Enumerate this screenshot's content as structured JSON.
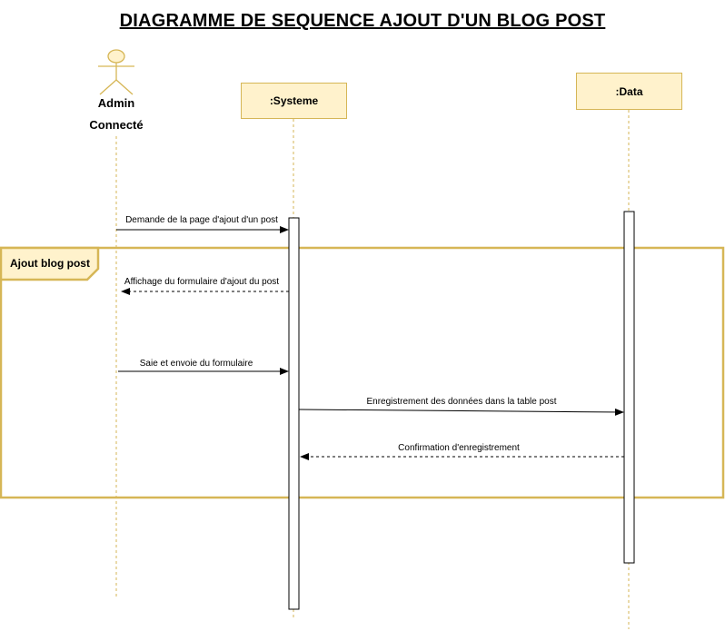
{
  "title": "DIAGRAMME DE SEQUENCE AJOUT D'UN BLOG POST",
  "actor": {
    "name": "Admin",
    "status": "Connecté"
  },
  "participants": [
    {
      "label": ":Systeme"
    },
    {
      "label": ":Data"
    }
  ],
  "frame": {
    "label": "Ajout blog post"
  },
  "messages": [
    {
      "text": "Demande de la page d'ajout d'un post"
    },
    {
      "text": "Affichage du formulaire d'ajout du post"
    },
    {
      "text": "Saie et envoie du formulaire"
    },
    {
      "text": "Enregistrement des données dans la table post"
    },
    {
      "text": "Confirmation d'enregistrement"
    }
  ],
  "colors": {
    "fill": "#fff2cc",
    "border": "#d6b656",
    "frame": "#d6b656"
  }
}
